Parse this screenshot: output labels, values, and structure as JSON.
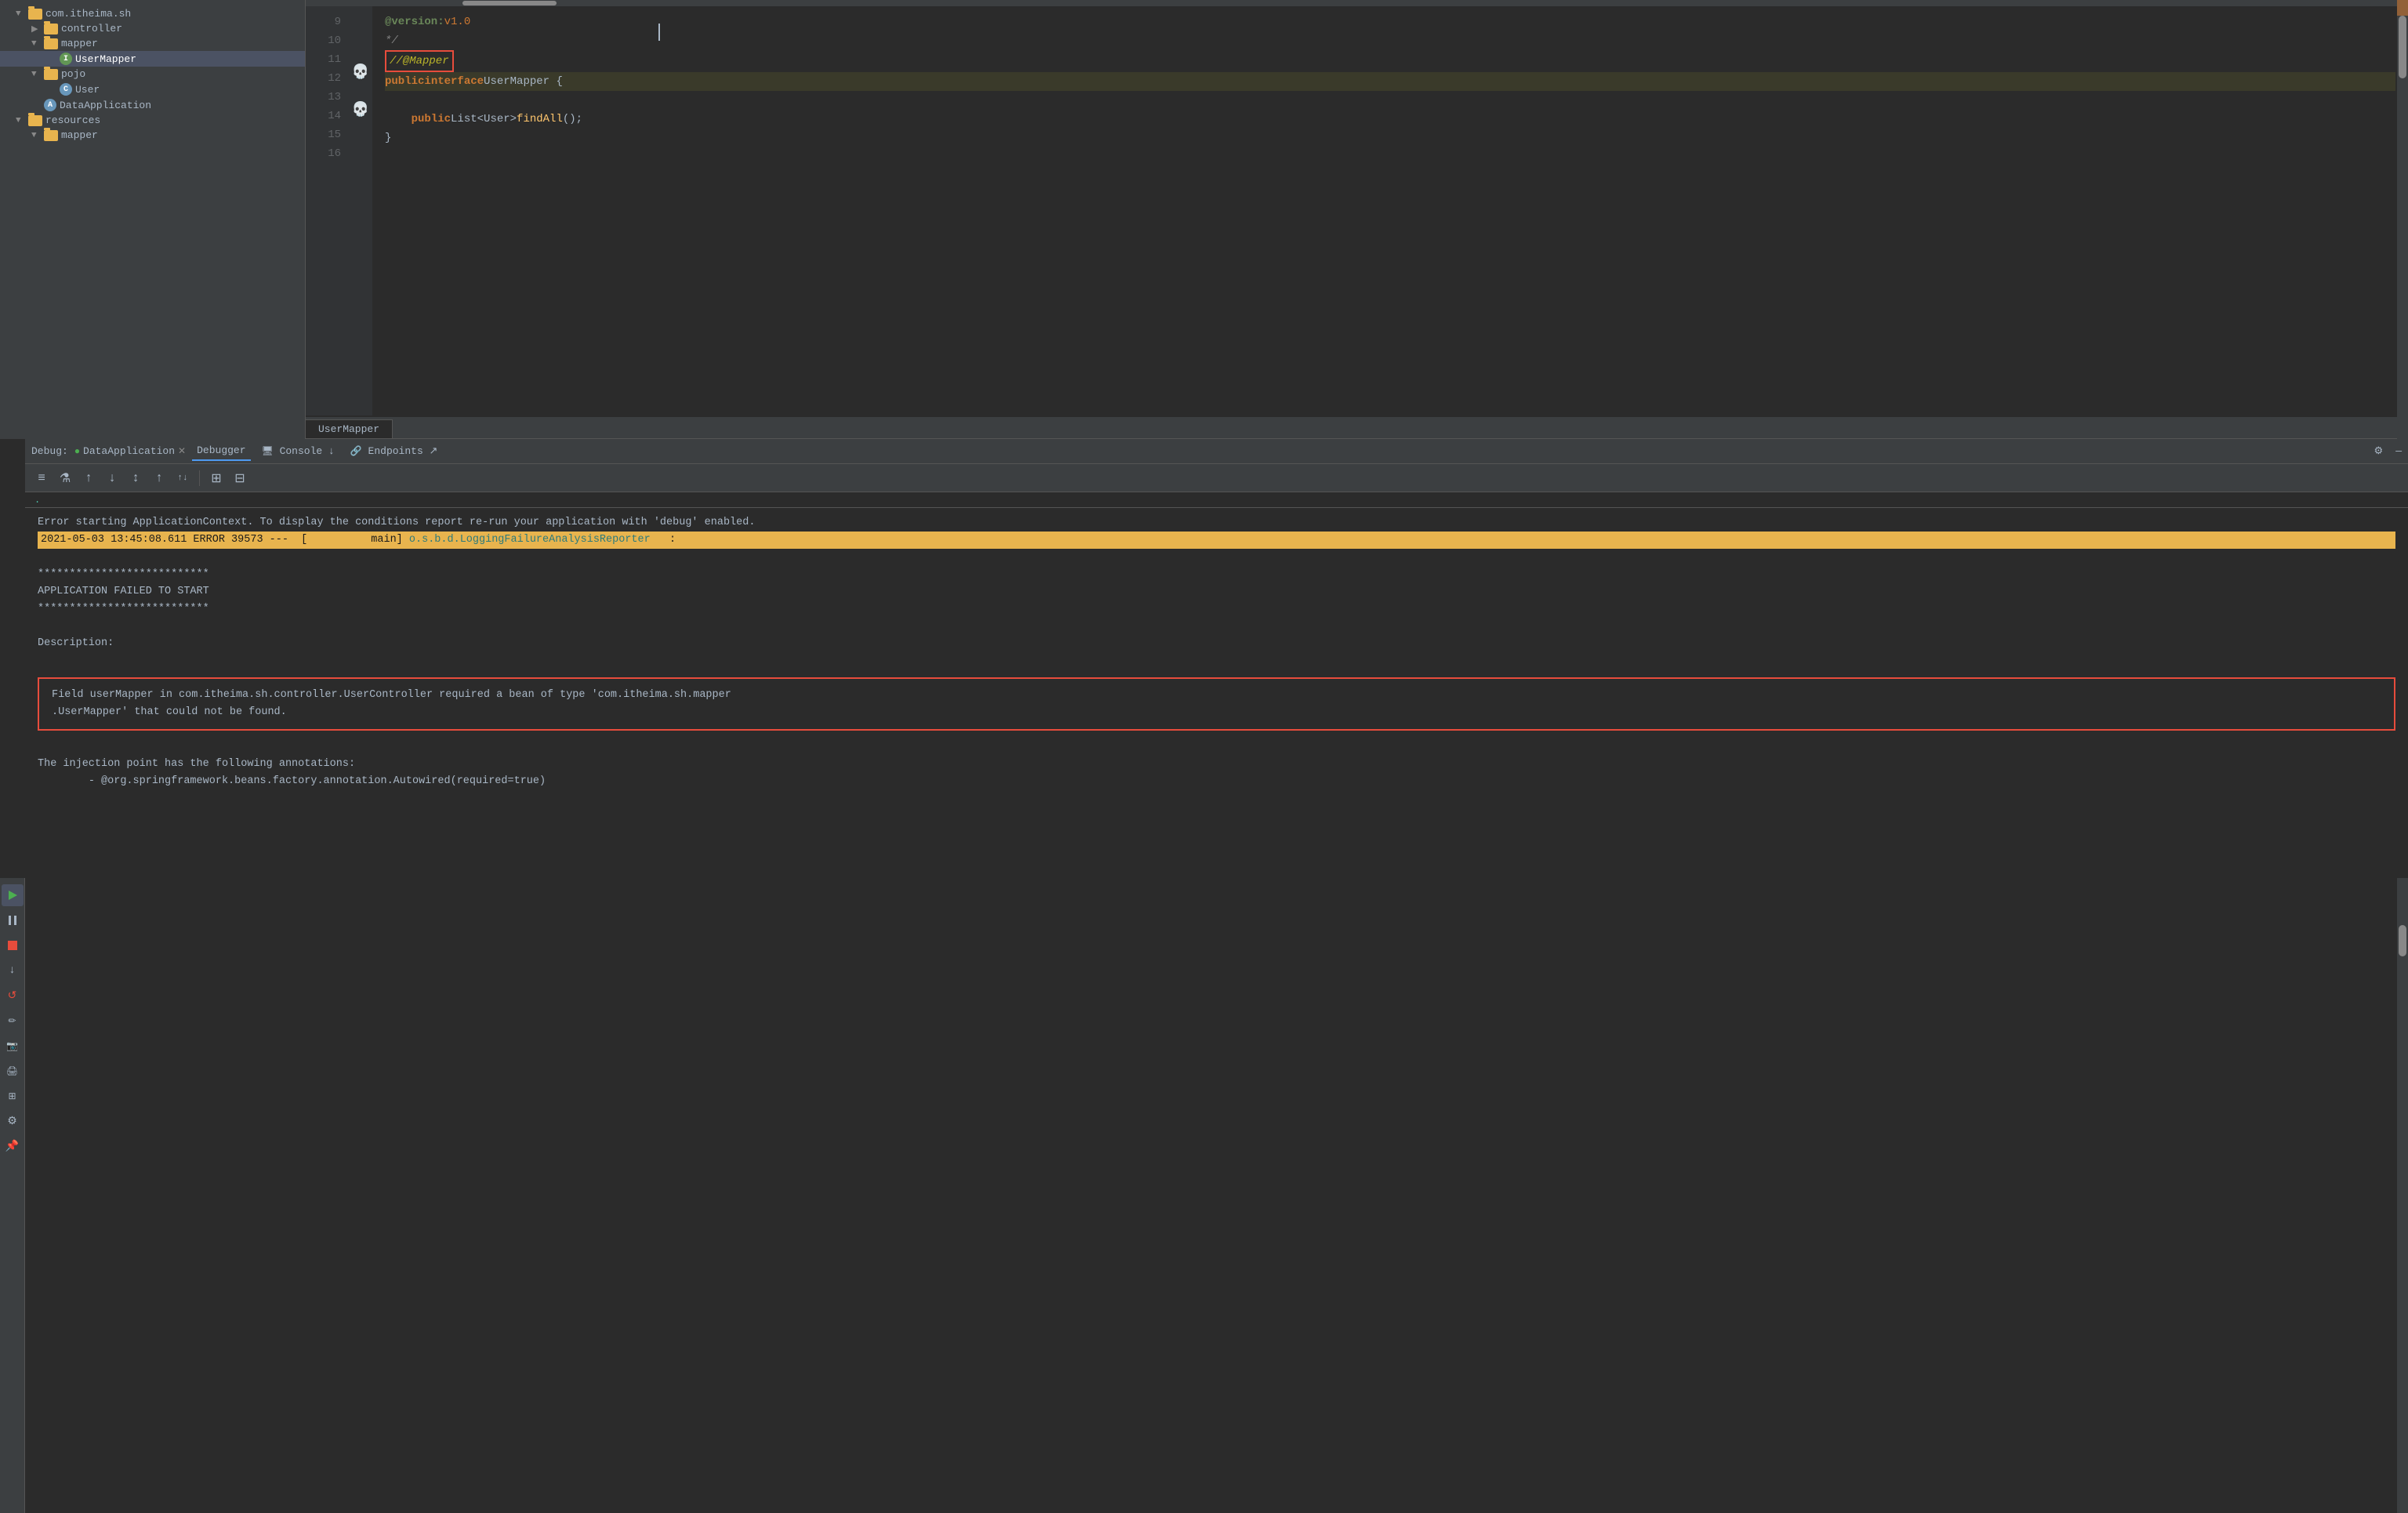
{
  "fileTree": {
    "items": [
      {
        "id": "com-itheima-sh",
        "label": "com.itheima.sh",
        "level": 0,
        "type": "folder",
        "expanded": true
      },
      {
        "id": "controller",
        "label": "controller",
        "level": 1,
        "type": "folder",
        "expanded": false
      },
      {
        "id": "mapper",
        "label": "mapper",
        "level": 1,
        "type": "folder",
        "expanded": true
      },
      {
        "id": "UserMapper",
        "label": "UserMapper",
        "level": 2,
        "type": "java-green",
        "selected": true
      },
      {
        "id": "pojo",
        "label": "pojo",
        "level": 1,
        "type": "folder",
        "expanded": true
      },
      {
        "id": "User",
        "label": "User",
        "level": 2,
        "type": "java-blue"
      },
      {
        "id": "DataApplication",
        "label": "DataApplication",
        "level": 1,
        "type": "java-blue"
      },
      {
        "id": "resources",
        "label": "resources",
        "level": 0,
        "type": "folder",
        "expanded": true
      },
      {
        "id": "mapper2",
        "label": "mapper",
        "level": 1,
        "type": "folder",
        "expanded": false
      }
    ]
  },
  "codeEditor": {
    "tabLabel": "UserMapper",
    "lines": [
      {
        "num": 9,
        "content": "@version: v1.0",
        "type": "version"
      },
      {
        "num": 10,
        "content": " */",
        "type": "comment"
      },
      {
        "num": 11,
        "content": "//@Mapper",
        "type": "annotation-commented",
        "hasBox": true
      },
      {
        "num": 12,
        "content": "public interface UserMapper {",
        "type": "code-interface",
        "highlighted": true,
        "hasBreakpoint": true
      },
      {
        "num": 13,
        "content": "",
        "type": "empty"
      },
      {
        "num": 14,
        "content": "    public List<User> findAll();",
        "type": "code-method",
        "hasBreakpoint": true
      },
      {
        "num": 15,
        "content": "}",
        "type": "code"
      },
      {
        "num": 16,
        "content": "",
        "type": "empty"
      }
    ]
  },
  "debugPanel": {
    "title": "Debug:",
    "sessionLabel": "DataApplication",
    "tabs": [
      "Debugger",
      "Console",
      "Endpoints"
    ],
    "activeTab": "Console",
    "settingsIcon": "⚙",
    "minimizeIcon": "—",
    "consoleOutput": {
      "lines": [
        {
          "type": "normal",
          "text": "Error starting ApplicationContext. To display the conditions report re-run your application with 'debug' enabled."
        },
        {
          "type": "error-highlight",
          "text": "2021-05-03 13:45:08.611 ERROR 39573 ---  [          main] o.s.b.d.LoggingFailureAnalysisReporter   :"
        },
        {
          "type": "normal",
          "text": ""
        },
        {
          "type": "normal",
          "text": "***************************"
        },
        {
          "type": "normal",
          "text": "APPLICATION FAILED TO START"
        },
        {
          "type": "normal",
          "text": "***************************"
        },
        {
          "type": "normal",
          "text": ""
        },
        {
          "type": "normal",
          "text": "Description:"
        },
        {
          "type": "normal",
          "text": ""
        },
        {
          "type": "error-box",
          "text": "Field userMapper in com.itheima.sh.controller.UserController required a bean of type 'com.itheima.sh.mapper\n.UserMapper' that could not be found."
        },
        {
          "type": "normal",
          "text": ""
        },
        {
          "type": "normal",
          "text": "The injection point has the following annotations:"
        },
        {
          "type": "normal",
          "text": "\t- @org.springframework.beans.factory.annotation.Autowired(required=true)"
        }
      ]
    }
  },
  "toolbar": {
    "buttons": [
      "≡",
      "↑",
      "↓",
      "↕",
      "↑",
      "↑↓",
      "⊞",
      "⊟"
    ]
  }
}
